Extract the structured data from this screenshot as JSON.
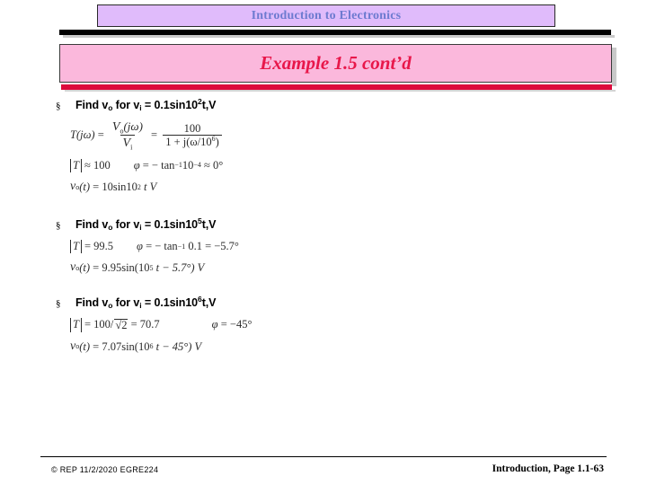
{
  "header": {
    "course_title": "Introduction to Electronics",
    "course_title_bg": "#E0BBFB",
    "course_title_color": "#6E7BD0",
    "slide_title": "Example 1.5 cont’d",
    "slide_title_bg": "#FBB8DC",
    "slide_title_color": "#E8174A",
    "rule_black": "#000000",
    "rule_red": "#DD0A3C"
  },
  "sections": [
    {
      "bullet_glyph": "§",
      "prompt": {
        "find": "Find v",
        "find_sub": "o",
        "for": " for v",
        "for_sub": "i",
        "eq": " = 0.1sin10",
        "exp": "2",
        "tail": "t,V"
      },
      "equations": {
        "transfer_lhs": "T(jω)",
        "transfer_num": "V",
        "transfer_num_sub": "o",
        "transfer_num_arg": "(jω)",
        "transfer_den": "V",
        "transfer_den_sub": "i",
        "rhs_num": "100",
        "rhs_den_lead": "1 + j(ω",
        "rhs_den_slash": "/",
        "rhs_den_base": "10",
        "rhs_den_exp": "6",
        "rhs_den_close": ")",
        "mag_label": "T",
        "mag_rel": "≈ 100",
        "phase_label": "φ",
        "phase_expr": "= − tan",
        "phase_exp": "−1",
        "phase_arg_base": "10",
        "phase_arg_exp": "−4",
        "phase_result": "≈ 0°",
        "out_lhs": "v",
        "out_lhs_sub": "o",
        "out_lhs_arg": "(t)",
        "out_rhs": "= 10sin10",
        "out_exp": "2",
        "out_tail": "t V"
      }
    },
    {
      "bullet_glyph": "§",
      "prompt": {
        "find": "Find v",
        "find_sub": "o",
        "for": " for v",
        "for_sub": "i",
        "eq": " = 0.1sin10",
        "exp": "5",
        "tail": "t,V"
      },
      "equations": {
        "mag_label": "T",
        "mag_rel": "= 99.5",
        "phase_label": "φ",
        "phase_expr": "= − tan",
        "phase_exp": "−1",
        "phase_arg": "0.1",
        "phase_result": "= −5.7°",
        "out_lhs": "v",
        "out_lhs_sub": "o",
        "out_lhs_arg": "(t)",
        "out_rhs": "= 9.95sin(10",
        "out_exp": "5",
        "out_tail": "t − 5.7°) V"
      }
    },
    {
      "bullet_glyph": "§",
      "prompt": {
        "find": "Find v",
        "find_sub": "o",
        "for": " for v",
        "for_sub": "i",
        "eq": " = 0.1sin10",
        "exp": "6",
        "tail": "t,V"
      },
      "equations": {
        "mag_label": "T",
        "mag_rel": "= 100/",
        "mag_sqrt": "2",
        "mag_value": "= 70.7",
        "phase_label": "φ",
        "phase_result": "= −45°",
        "out_lhs": "v",
        "out_lhs_sub": "o",
        "out_lhs_arg": "(t)",
        "out_rhs": "= 7.07sin(10",
        "out_exp": "6",
        "out_tail": "t − 45°) V"
      }
    }
  ],
  "footer": {
    "left": "© REP  11/2/2020  EGRE224",
    "right": "Introduction, Page 1.1-63"
  }
}
